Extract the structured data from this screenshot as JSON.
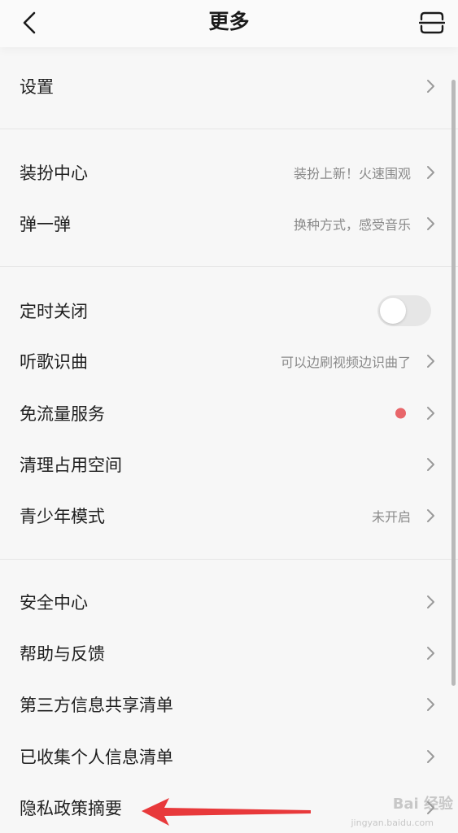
{
  "header": {
    "title": "更多",
    "back_icon": "chevron-left-icon",
    "scan_icon": "scan-icon"
  },
  "sections": [
    {
      "items": [
        {
          "label": "设置",
          "hint": ""
        }
      ]
    },
    {
      "items": [
        {
          "label": "装扮中心",
          "hint": "装扮上新！火速围观"
        },
        {
          "label": "弹一弹",
          "hint": "换种方式，感受音乐"
        }
      ]
    },
    {
      "items": [
        {
          "label": "定时关闭",
          "hint": "",
          "toggle": {
            "on": false
          }
        },
        {
          "label": "听歌识曲",
          "hint": "可以边刷视频边识曲了"
        },
        {
          "label": "免流量服务",
          "hint": "",
          "badge": "red-dot"
        },
        {
          "label": "清理占用空间",
          "hint": ""
        },
        {
          "label": "青少年模式",
          "hint": "未开启"
        }
      ]
    },
    {
      "items": [
        {
          "label": "安全中心",
          "hint": ""
        },
        {
          "label": "帮助与反馈",
          "hint": ""
        },
        {
          "label": "第三方信息共享清单",
          "hint": ""
        },
        {
          "label": "已收集个人信息清单",
          "hint": ""
        },
        {
          "label": "隐私政策摘要",
          "hint": ""
        }
      ]
    }
  ],
  "watermark": {
    "text": "Bai 经验",
    "sub": "jingyan.baidu.com"
  },
  "colors": {
    "background": "#f7f7f7",
    "text": "#1f1f1f",
    "hint": "#8a8a8a",
    "badge": "#e8666a",
    "arrow": "#e8393b"
  }
}
